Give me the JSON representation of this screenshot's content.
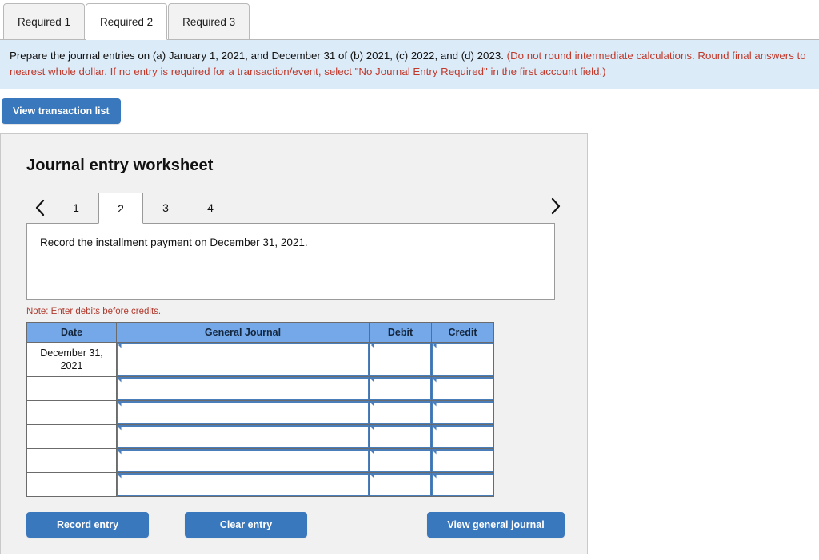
{
  "top_tabs": [
    {
      "label": "Required 1",
      "active": false
    },
    {
      "label": "Required 2",
      "active": true
    },
    {
      "label": "Required 3",
      "active": false
    }
  ],
  "instructions": {
    "black_text": "Prepare the journal entries on (a) January 1, 2021, and December 31 of (b) 2021, (c) 2022, and (d) 2023. ",
    "red_text": "(Do not round intermediate calculations. Round final answers to nearest whole dollar. If no entry is required for a transaction/event, select \"No Journal Entry Required\" in the first account field.)"
  },
  "toolbar": {
    "view_transaction_list_label": "View transaction list"
  },
  "worksheet": {
    "title": "Journal entry worksheet",
    "pager": {
      "prev_icon": "chevron-left-icon",
      "next_icon": "chevron-right-icon",
      "prev_glyph": "‹",
      "next_glyph": "›",
      "pages": [
        "1",
        "2",
        "3",
        "4"
      ],
      "active_page": "2"
    },
    "description": "Record the installment payment on December 31, 2021.",
    "note": "Note: Enter debits before credits.",
    "table": {
      "headers": [
        "Date",
        "General Journal",
        "Debit",
        "Credit"
      ],
      "rows": [
        {
          "date": "December 31, 2021",
          "general_journal": "",
          "debit": "",
          "credit": ""
        },
        {
          "date": "",
          "general_journal": "",
          "debit": "",
          "credit": ""
        },
        {
          "date": "",
          "general_journal": "",
          "debit": "",
          "credit": ""
        },
        {
          "date": "",
          "general_journal": "",
          "debit": "",
          "credit": ""
        },
        {
          "date": "",
          "general_journal": "",
          "debit": "",
          "credit": ""
        },
        {
          "date": "",
          "general_journal": "",
          "debit": "",
          "credit": ""
        }
      ]
    },
    "buttons": {
      "record_entry": "Record entry",
      "clear_entry": "Clear entry",
      "view_general_journal": "View general journal"
    }
  },
  "colors": {
    "button_blue": "#3a78be",
    "table_header_blue": "#74a8e8",
    "banner_blue": "#dcebf8",
    "panel_gray": "#f1f1f1",
    "note_red": "#b03a2e",
    "instruction_red": "#c0392b",
    "cell_border_blue": "#4a7ebb"
  }
}
